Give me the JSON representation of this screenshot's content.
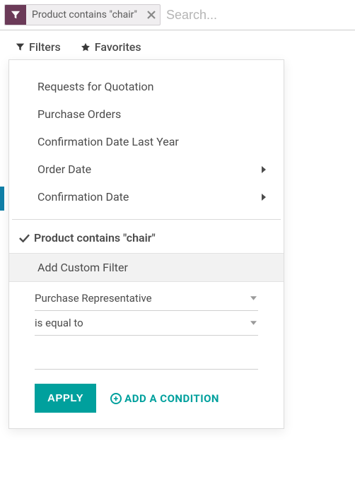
{
  "search": {
    "facet_label": "Product contains \"chair\"",
    "placeholder": "Search..."
  },
  "tabs": {
    "filters": "Filters",
    "favorites": "Favorites"
  },
  "filters": {
    "items": [
      {
        "label": "Requests for Quotation",
        "has_submenu": false
      },
      {
        "label": "Purchase Orders",
        "has_submenu": false
      },
      {
        "label": "Confirmation Date Last Year",
        "has_submenu": false
      },
      {
        "label": "Order Date",
        "has_submenu": true
      },
      {
        "label": "Confirmation Date",
        "has_submenu": true
      }
    ],
    "active_group_label": "Product contains \"chair\""
  },
  "custom_filter": {
    "heading": "Add Custom Filter",
    "field": "Purchase Representative",
    "operator": "is equal to",
    "value": "",
    "apply_label": "APPLY",
    "add_condition_label": "ADD A CONDITION"
  },
  "colors": {
    "primary": "#00a09d",
    "facet_bg": "#6b3a58"
  }
}
